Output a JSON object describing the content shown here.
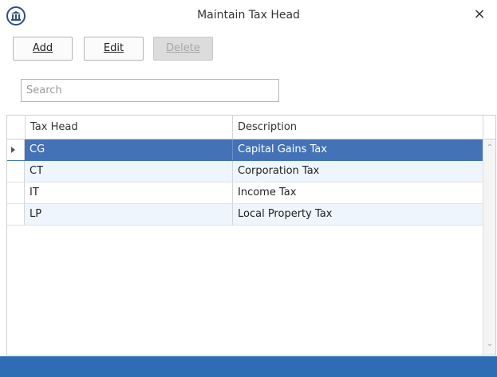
{
  "window": {
    "title": "Maintain Tax Head",
    "close_icon": "×"
  },
  "toolbar": {
    "add_label": "Add",
    "edit_label": "Edit",
    "delete_label": "Delete"
  },
  "search": {
    "placeholder": "Search",
    "value": ""
  },
  "table": {
    "columns": [
      "Tax Head",
      "Description"
    ],
    "rows": [
      {
        "tax_head": "CG",
        "description": "Capital Gains Tax"
      },
      {
        "tax_head": "CT",
        "description": "Corporation Tax"
      },
      {
        "tax_head": "IT",
        "description": "Income Tax"
      },
      {
        "tax_head": "LP",
        "description": "Local Property Tax"
      }
    ]
  },
  "colors": {
    "selection": "#4472b6",
    "alt_row": "#eef5fc",
    "status_bar": "#2e6db4"
  }
}
